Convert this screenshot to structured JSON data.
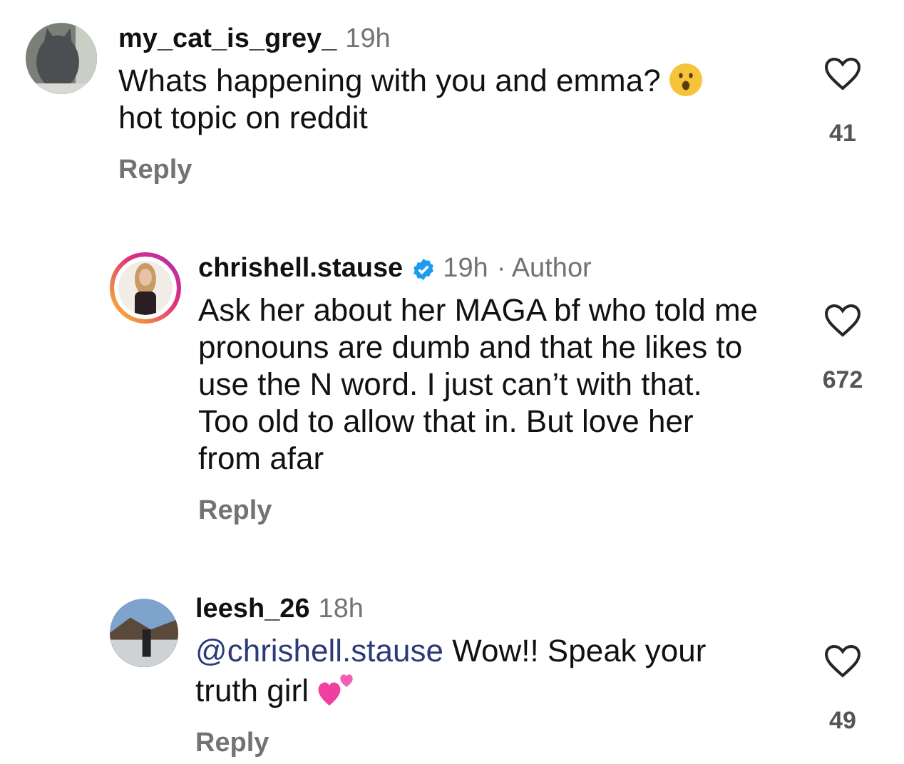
{
  "comments": [
    {
      "username": "my_cat_is_grey_",
      "time": "19h",
      "verified": false,
      "reply": false,
      "story_ring": false,
      "text": "Whats happening with you and emma?",
      "text_after": "hot topic on reddit",
      "emoji": {
        "kind": "surprised"
      },
      "likes": "41",
      "reply_label": "Reply"
    },
    {
      "username": "chrishell.stause",
      "time": "19h",
      "verified": true,
      "author_label": "· Author",
      "reply": true,
      "story_ring": true,
      "lines": [
        "Ask her about her MAGA bf who told me",
        "pronouns are dumb and that he likes to",
        "use the N word. I just can’t with that.",
        "Too old to allow that in. But love her",
        "from afar"
      ],
      "likes": "672",
      "reply_label": "Reply"
    },
    {
      "username": "leesh_26",
      "time": "18h",
      "verified": false,
      "reply": true,
      "story_ring": false,
      "mention": "@chrishell.stause",
      "text": "Wow!! Speak your truth girl",
      "emoji": {
        "kind": "hearts"
      },
      "likes": "49",
      "reply_label": "Reply"
    }
  ]
}
